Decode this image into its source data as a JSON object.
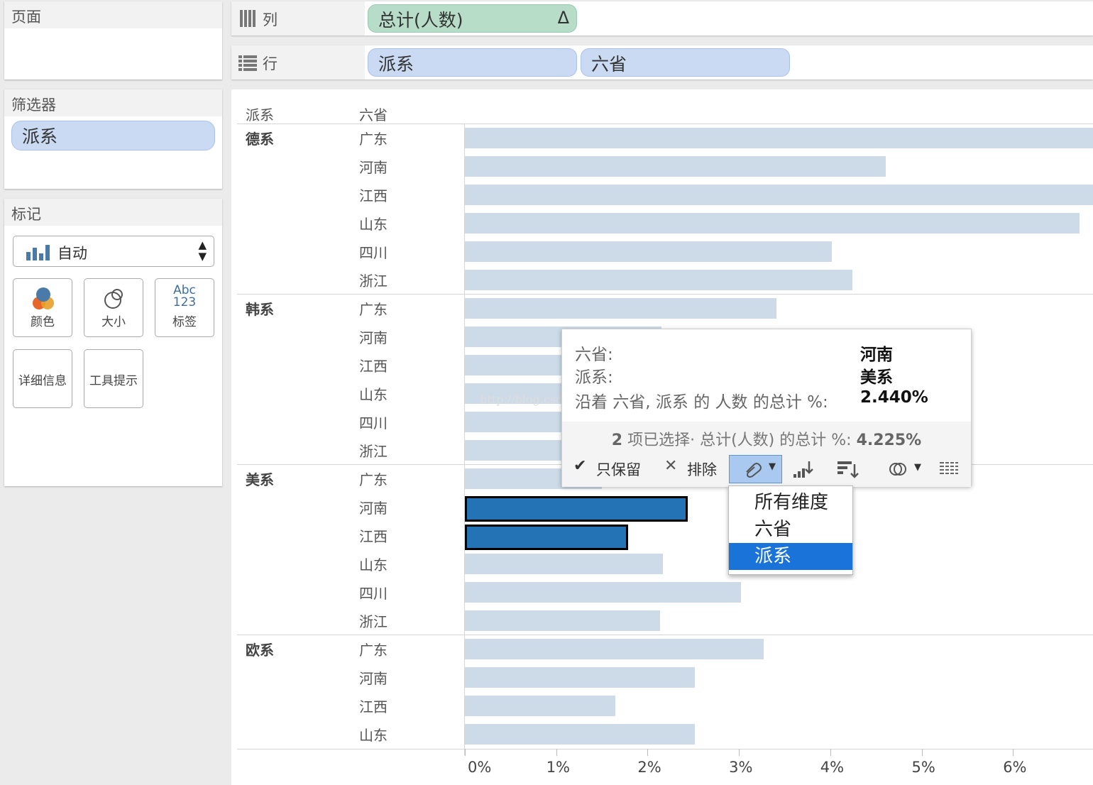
{
  "panels": {
    "pages": {
      "title": "页面"
    },
    "filters": {
      "title": "筛选器",
      "pill": "派系"
    },
    "marks": {
      "title": "标记",
      "type": "自动",
      "buttons": {
        "color": "颜色",
        "size": "大小",
        "label": "标签",
        "label_icon_top": "Abc",
        "label_icon_bottom": "123",
        "detail": "详细信息",
        "tooltip": "工具提示"
      }
    }
  },
  "shelves": {
    "columns": {
      "label": "列",
      "pill": "总计(人数)",
      "delta": "Δ"
    },
    "rows": {
      "label": "行",
      "pills": [
        "派系",
        "六省"
      ]
    }
  },
  "view": {
    "header_left": "派系",
    "header_right": "六省",
    "groups": [
      {
        "name": "德系",
        "rows": [
          {
            "province": "广东",
            "value": 6.95
          },
          {
            "province": "河南",
            "value": 4.61
          },
          {
            "province": "江西",
            "value": 6.95
          },
          {
            "province": "山东",
            "value": 6.73
          },
          {
            "province": "四川",
            "value": 4.02
          },
          {
            "province": "浙江",
            "value": 4.24
          }
        ]
      },
      {
        "name": "韩系",
        "rows": [
          {
            "province": "广东",
            "value": 3.41
          },
          {
            "province": "河南",
            "value": 2.15
          },
          {
            "province": "江西",
            "value": 1.5
          },
          {
            "province": "山东",
            "value": 1.5
          },
          {
            "province": "四川",
            "value": 1.5
          },
          {
            "province": "浙江",
            "value": 1.5
          }
        ]
      },
      {
        "name": "美系",
        "rows": [
          {
            "province": "广东",
            "value": 1.5
          },
          {
            "province": "河南",
            "value": 2.44,
            "selected": true
          },
          {
            "province": "江西",
            "value": 1.785,
            "selected": true
          },
          {
            "province": "山东",
            "value": 2.17
          },
          {
            "province": "四川",
            "value": 3.02
          },
          {
            "province": "浙江",
            "value": 2.14
          }
        ]
      },
      {
        "name": "欧系",
        "rows": [
          {
            "province": "广东",
            "value": 3.27
          },
          {
            "province": "河南",
            "value": 2.52
          },
          {
            "province": "江西",
            "value": 1.65
          },
          {
            "province": "山东",
            "value": 2.52
          }
        ]
      }
    ],
    "x_ticks": [
      "0%",
      "1%",
      "2%",
      "3%",
      "4%",
      "5%",
      "6%"
    ]
  },
  "tooltip": {
    "rows": [
      {
        "label": "六省:",
        "value": "河南"
      },
      {
        "label": "派系:",
        "value": "美系"
      },
      {
        "label": "沿着 六省, 派系 的 人数 的总计 %:",
        "value": "2.440%"
      }
    ],
    "summary_count": "2",
    "summary_text": "项已选择· 总计(人数) 的总计 %:",
    "summary_value": "4.225%",
    "actions": {
      "keep_only": "只保留",
      "exclude": "排除"
    }
  },
  "watermark": "http://blog.csdn.ne",
  "dropdown": {
    "items": [
      "所有维度",
      "六省",
      "派系"
    ],
    "selected": "派系"
  },
  "colors": {
    "bar": "#cddbe8",
    "bar_selected": "#2474b5",
    "pill_blue": "#c9daf2",
    "pill_green": "#b7dcc8",
    "menu_active": "#1a73d8"
  }
}
